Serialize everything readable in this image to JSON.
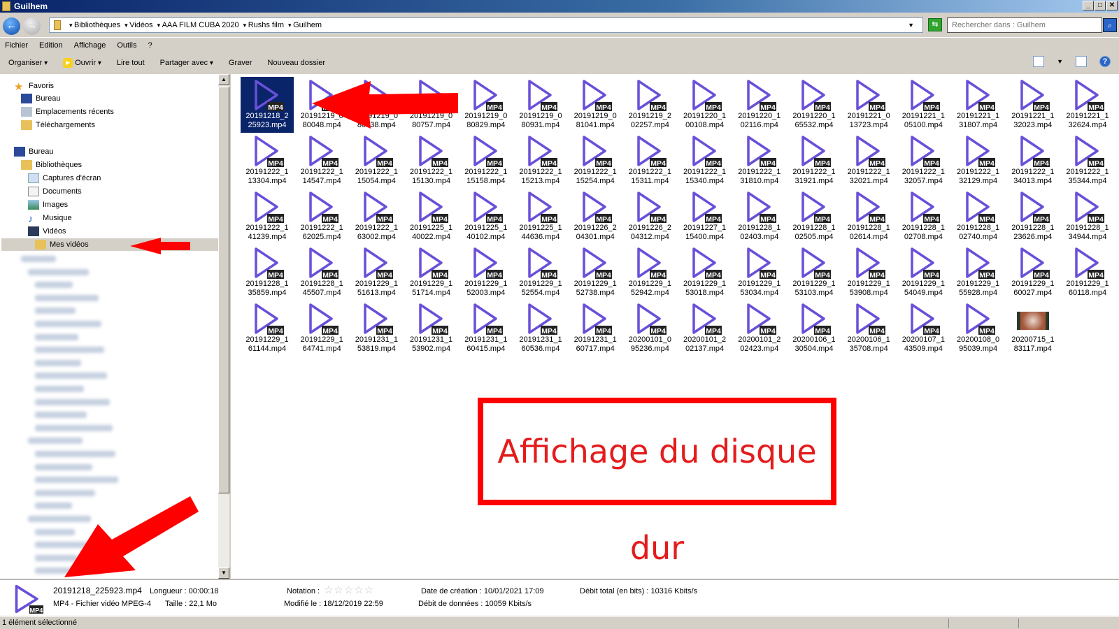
{
  "window": {
    "title": "Guilhem"
  },
  "address": {
    "crumbs": [
      "Bibliothèques",
      "Vidéos",
      "AAA FILM CUBA 2020",
      "Rushs film",
      "Guilhem"
    ],
    "search_placeholder": "Rechercher dans : Guilhem"
  },
  "menu": [
    "Fichier",
    "Edition",
    "Affichage",
    "Outils",
    "?"
  ],
  "toolbar": {
    "organiser": "Organiser",
    "ouvrir": "Ouvrir",
    "lire_tout": "Lire tout",
    "partager": "Partager avec",
    "graver": "Graver",
    "nouveau_dossier": "Nouveau dossier"
  },
  "sidebar": {
    "favoris": "Favoris",
    "fav_items": [
      "Bureau",
      "Emplacements récents",
      "Téléchargements"
    ],
    "bureau": "Bureau",
    "bibliotheques": "Bibliothèques",
    "lib_items": [
      "Captures d'écran",
      "Documents",
      "Images",
      "Musique",
      "Vidéos"
    ],
    "selected": "Mes vidéos"
  },
  "badge": "MP4",
  "files": [
    "20191218_225923.mp4",
    "20191219_080048.mp4",
    "20191219_080338.mp4",
    "20191219_080757.mp4",
    "20191219_080829.mp4",
    "20191219_080931.mp4",
    "20191219_081041.mp4",
    "20191219_202257.mp4",
    "20191220_100108.mp4",
    "20191220_102116.mp4",
    "20191220_165532.mp4",
    "20191221_013723.mp4",
    "20191221_105100.mp4",
    "20191221_131807.mp4",
    "20191221_132023.mp4",
    "20191221_132624.mp4",
    "20191222_113304.mp4",
    "20191222_114547.mp4",
    "20191222_115054.mp4",
    "20191222_115130.mp4",
    "20191222_115158.mp4",
    "20191222_115213.mp4",
    "20191222_115254.mp4",
    "20191222_115311.mp4",
    "20191222_115340.mp4",
    "20191222_131810.mp4",
    "20191222_131921.mp4",
    "20191222_132021.mp4",
    "20191222_132057.mp4",
    "20191222_132129.mp4",
    "20191222_134013.mp4",
    "20191222_135344.mp4",
    "20191222_141239.mp4",
    "20191222_162025.mp4",
    "20191222_163002.mp4",
    "20191225_140022.mp4",
    "20191225_140102.mp4",
    "20191225_144636.mp4",
    "20191226_204301.mp4",
    "20191226_204312.mp4",
    "20191227_115400.mp4",
    "20191228_102403.mp4",
    "20191228_102505.mp4",
    "20191228_102614.mp4",
    "20191228_102708.mp4",
    "20191228_102740.mp4",
    "20191228_123626.mp4",
    "20191228_134944.mp4",
    "20191228_135859.mp4",
    "20191228_145507.mp4",
    "20191229_151613.mp4",
    "20191229_151714.mp4",
    "20191229_152003.mp4",
    "20191229_152554.mp4",
    "20191229_152738.mp4",
    "20191229_152942.mp4",
    "20191229_153018.mp4",
    "20191229_153034.mp4",
    "20191229_153103.mp4",
    "20191229_153908.mp4",
    "20191229_154049.mp4",
    "20191229_155928.mp4",
    "20191229_160027.mp4",
    "20191229_160118.mp4",
    "20191229_161144.mp4",
    "20191229_164741.mp4",
    "20191231_153819.mp4",
    "20191231_153902.mp4",
    "20191231_160415.mp4",
    "20191231_160536.mp4",
    "20191231_160717.mp4",
    "20200101_095236.mp4",
    "20200101_202137.mp4",
    "20200101_202423.mp4",
    "20200106_130504.mp4",
    "20200106_135708.mp4",
    "20200107_143509.mp4",
    "20200108_095039.mp4",
    "20200715_183117.mp4"
  ],
  "annotation": "Affichage du disque dur",
  "details": {
    "name": "20191218_225923.mp4",
    "type": "MP4 - Fichier vidéo MPEG-4",
    "length": "Longueur : 00:00:18",
    "size": "Taille : 22,1 Mo",
    "rating_label": "Notation :",
    "rating": 0,
    "modified": "Modifié le : 18/12/2019 22:59",
    "created": "Date de création : 10/01/2021 17:09",
    "data_rate": "Débit de données : 10059 Kbits/s",
    "total_rate": "Débit total (en bits) : 10316 Kbits/s"
  },
  "status": "1 élément sélectionné",
  "colors": {
    "icon": "#6a4fd8",
    "annotation": "#ff0000",
    "selection": "#0a246a"
  }
}
